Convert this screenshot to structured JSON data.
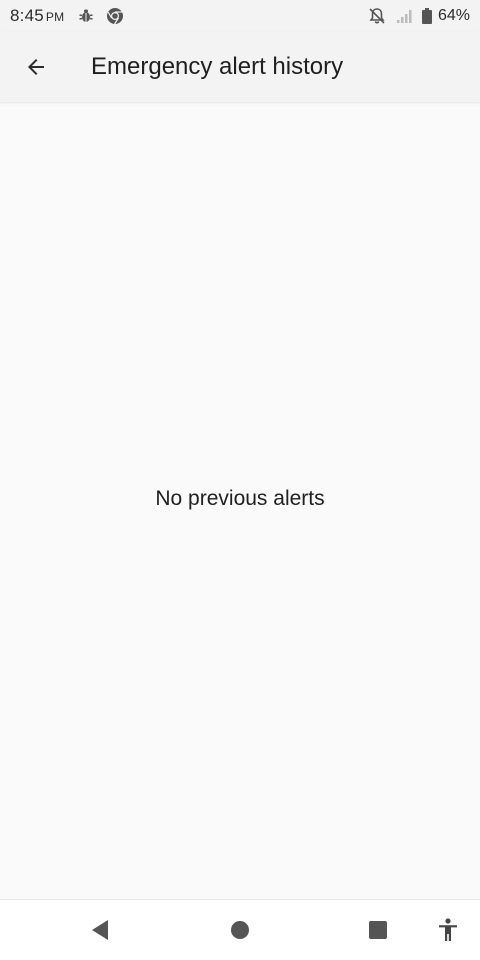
{
  "status_bar": {
    "time": "8:45",
    "ampm": "PM",
    "battery_percent": "64%",
    "icons": [
      "bug-icon",
      "chrome-icon",
      "notifications-off-icon",
      "signal-icon",
      "battery-icon"
    ]
  },
  "app_bar": {
    "back_icon": "arrow-back-icon",
    "title": "Emergency alert history"
  },
  "content": {
    "empty_message": "No previous alerts"
  },
  "nav_bar": {
    "buttons": [
      "back-triangle-icon",
      "home-circle-icon",
      "recents-square-icon",
      "accessibility-icon"
    ]
  },
  "colors": {
    "background": "#fafafa",
    "bar_background": "#f3f3f3",
    "text": "#1f1f1f",
    "nav_icon": "#555555"
  }
}
